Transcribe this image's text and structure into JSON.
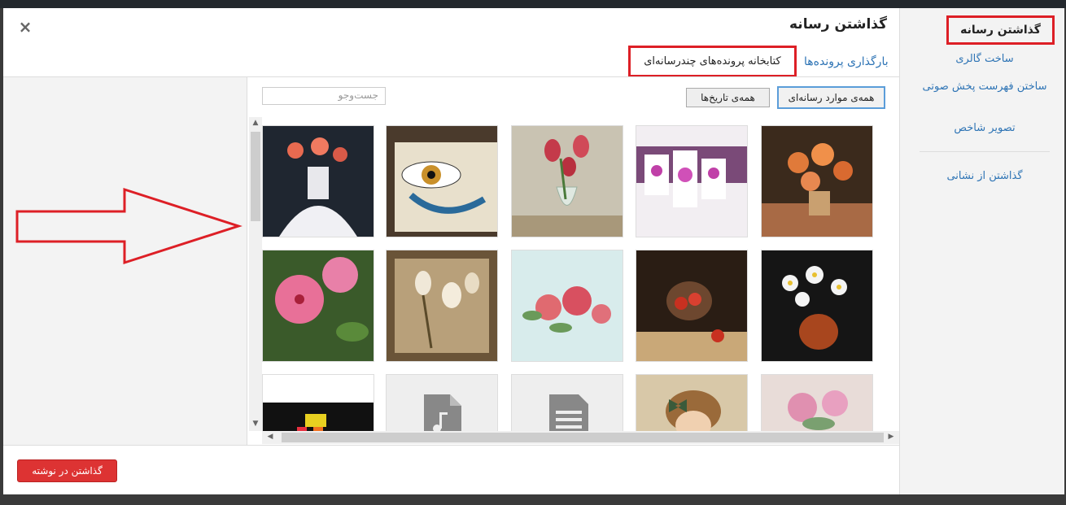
{
  "frame": {
    "title": "گذاشتن رسانه",
    "close_label": "×"
  },
  "tabs": {
    "upload": "بارگذاری پرونده‌ها",
    "library": "کتابخانه پرونده‌های چندرسانه‌ای"
  },
  "menu": {
    "title": "گذاشتن رسانه",
    "items": [
      "ساخت گالری",
      "ساختن فهرست پخش صوتی",
      "تصویر شاخص",
      "گذاشتن از نشانی"
    ]
  },
  "toolbar": {
    "filter_type": "همه‌ی موارد رسانه‌ای",
    "filter_dates": "همه‌ی تاریخ‌ها",
    "search_placeholder": "جست‌وجو"
  },
  "footer": {
    "insert_button": "گذاشتن در نوشته"
  },
  "media": [
    {
      "name": "orange-flowers-vase"
    },
    {
      "name": "orchid-canvas-art"
    },
    {
      "name": "tulips-glass-vase"
    },
    {
      "name": "painted-eye"
    },
    {
      "name": "flower-woman-vase"
    },
    {
      "name": "daisies-brown-vase"
    },
    {
      "name": "fruit-glass-bowl"
    },
    {
      "name": "roses-watercolor"
    },
    {
      "name": "sepia-tulips"
    },
    {
      "name": "pink-hibiscus"
    },
    {
      "name": "pink-peonies"
    },
    {
      "name": "girl-with-bow"
    },
    {
      "name": "document-file"
    },
    {
      "name": "audio-file"
    },
    {
      "name": "dark-colorful-image"
    }
  ],
  "colors": {
    "accent": "#dd3333",
    "link": "#2e74b5",
    "highlight": "#dd1f26"
  }
}
